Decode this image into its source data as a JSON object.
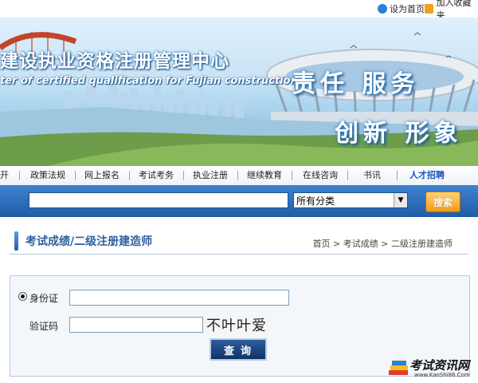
{
  "top_links": {
    "set_home": "设为首页",
    "add_favorite": "加入收藏夹"
  },
  "banner": {
    "title": "建设执业资格注册管理中心",
    "subtitle": "ter of certified qualification for Fujian construction",
    "slogan_line1": "责任  服务",
    "slogan_line2": "创新  形象"
  },
  "nav": {
    "items": [
      {
        "label": "开"
      },
      {
        "label": "政策法规"
      },
      {
        "label": "网上报名"
      },
      {
        "label": "考试考务"
      },
      {
        "label": "执业注册"
      },
      {
        "label": "继续教育"
      },
      {
        "label": "在线咨询"
      },
      {
        "label": "书讯"
      },
      {
        "label": "人才招聘"
      }
    ]
  },
  "search": {
    "placeholder": "",
    "category_selected": "所有分类",
    "button_label": "搜索"
  },
  "page": {
    "title": "考试成绩/二级注册建造师",
    "breadcrumb": [
      "首页",
      "考试成绩",
      "二级注册建造师"
    ],
    "breadcrumb_sep": " > "
  },
  "form": {
    "id_label": "身份证",
    "captcha_label": "验证码",
    "captcha_text": "不叶叶爱",
    "submit_label": "查询"
  },
  "watermark": {
    "text": "考试资讯网",
    "url": "www.KaoShi86.Com"
  },
  "colors": {
    "nav_hot": "#1b53b7",
    "search_bar": "#2f6fbf",
    "title_blue": "#2e5f9e",
    "button_orange": "#f39a12"
  }
}
